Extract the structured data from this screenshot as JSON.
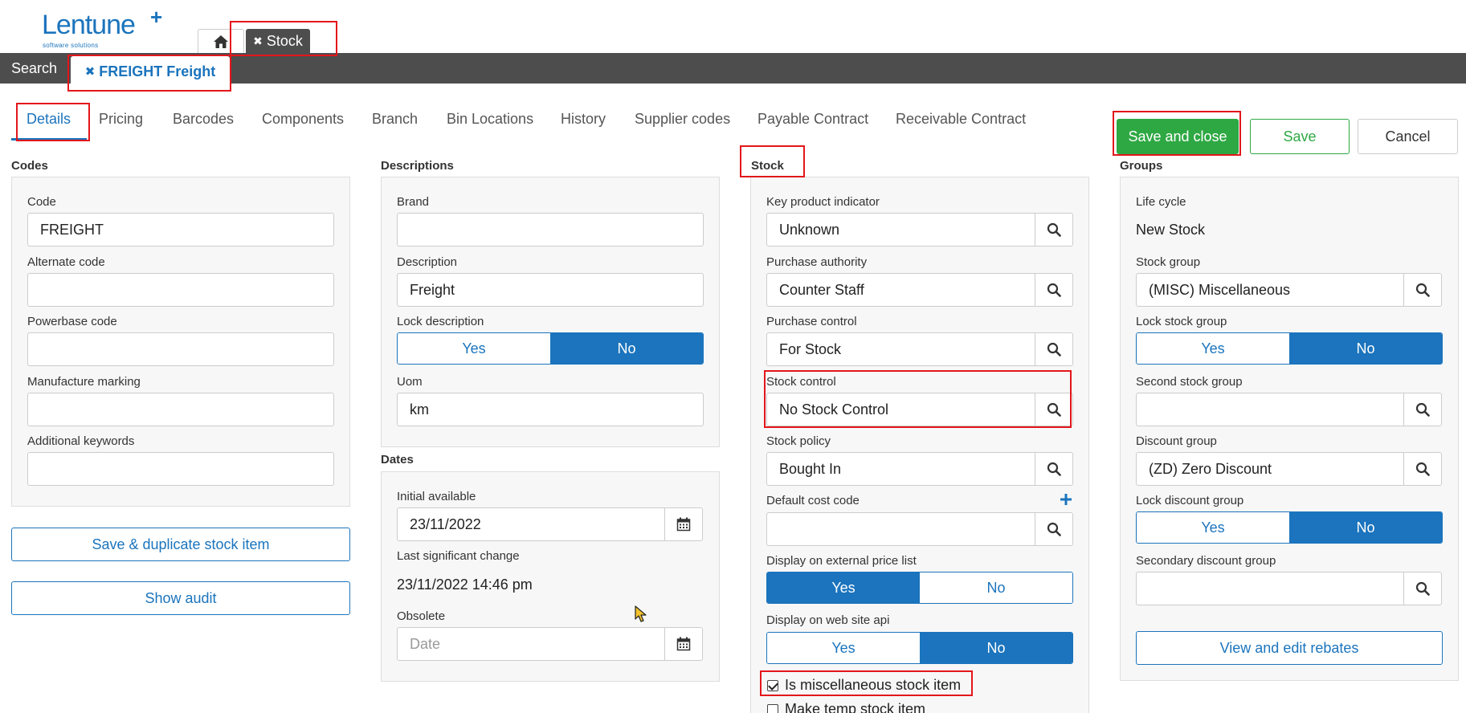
{
  "header": {
    "logo_text": "Lentune",
    "logo_plus": "+",
    "logo_sub": "software solutions",
    "stock_tab_label": "Stock",
    "search_label": "Search",
    "record_tab_label": "FREIGHT Freight",
    "close_glyph": "✖"
  },
  "tabs": [
    "Details",
    "Pricing",
    "Barcodes",
    "Components",
    "Branch",
    "Bin Locations",
    "History",
    "Supplier codes",
    "Payable Contract",
    "Receivable Contract"
  ],
  "actions": {
    "save_close": "Save and close",
    "save": "Save",
    "cancel": "Cancel"
  },
  "codes": {
    "title": "Codes",
    "code_label": "Code",
    "code_value": "FREIGHT",
    "alternate_label": "Alternate code",
    "alternate_value": "",
    "powerbase_label": "Powerbase code",
    "powerbase_value": "",
    "manufacture_label": "Manufacture marking",
    "manufacture_value": "",
    "keywords_label": "Additional keywords",
    "keywords_value": "",
    "save_duplicate": "Save & duplicate stock item",
    "show_audit": "Show audit"
  },
  "descriptions": {
    "title": "Descriptions",
    "brand_label": "Brand",
    "brand_value": "",
    "description_label": "Description",
    "description_value": "Freight",
    "lock_label": "Lock description",
    "yes": "Yes",
    "no": "No",
    "uom_label": "Uom",
    "uom_value": "km"
  },
  "dates": {
    "title": "Dates",
    "initial_label": "Initial available",
    "initial_value": "23/11/2022",
    "last_change_label": "Last significant change",
    "last_change_value": "23/11/2022 14:46 pm",
    "obsolete_label": "Obsolete",
    "obsolete_placeholder": "Date"
  },
  "stock": {
    "title": "Stock",
    "kpi_label": "Key product indicator",
    "kpi_value": "Unknown",
    "purchase_authority_label": "Purchase authority",
    "purchase_authority_value": "Counter Staff",
    "purchase_control_label": "Purchase control",
    "purchase_control_value": "For Stock",
    "stock_control_label": "Stock control",
    "stock_control_value": "No Stock Control",
    "stock_policy_label": "Stock policy",
    "stock_policy_value": "Bought In",
    "cost_code_label": "Default cost code",
    "cost_code_value": "",
    "external_price_label": "Display on external price list",
    "web_api_label": "Display on web site api",
    "yes": "Yes",
    "no": "No",
    "misc_label": "Is miscellaneous stock item",
    "misc_checked": true,
    "temp_label": "Make temp stock item",
    "temp_checked": false
  },
  "groups": {
    "title": "Groups",
    "lifecycle_label": "Life cycle",
    "lifecycle_value": "New Stock",
    "stock_group_label": "Stock group",
    "stock_group_value": "(MISC) Miscellaneous",
    "lock_stock_group_label": "Lock stock group",
    "second_group_label": "Second stock group",
    "second_group_value": "",
    "discount_group_label": "Discount group",
    "discount_group_value": "(ZD) Zero Discount",
    "lock_discount_label": "Lock discount group",
    "secondary_discount_label": "Secondary discount group",
    "secondary_discount_value": "",
    "yes": "Yes",
    "no": "No",
    "rebates": "View and edit rebates"
  },
  "colors": {
    "accent": "#1b74bd",
    "success": "#2ea843",
    "dark_bar": "#4d4d4d",
    "highlight": "#e3161b"
  }
}
